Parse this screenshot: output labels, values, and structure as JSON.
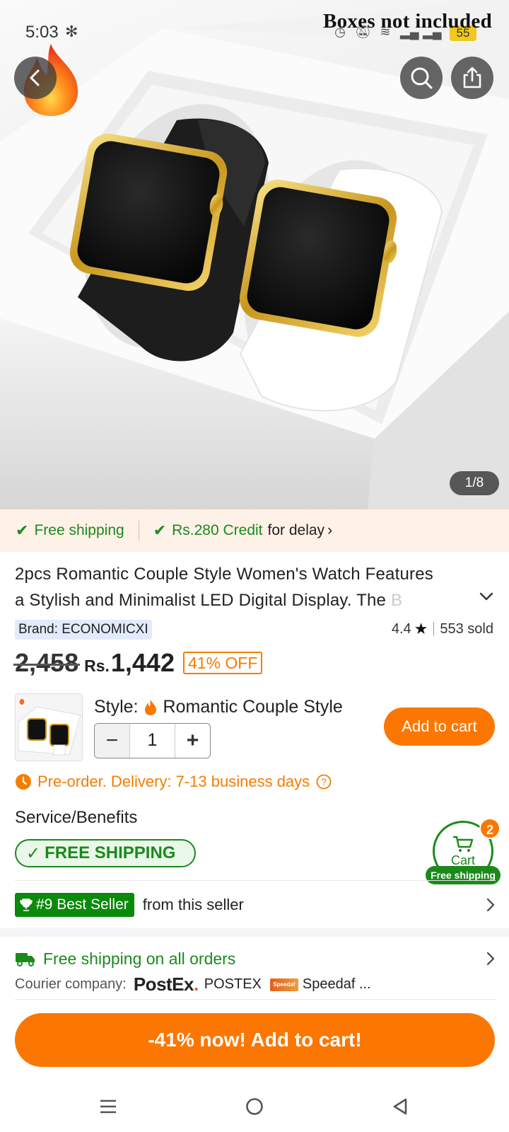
{
  "status_bar": {
    "time": "5:03",
    "battery": "55"
  },
  "hero": {
    "overlay_text": "Boxes not included",
    "image_counter": "1/8",
    "icons": [
      "back-icon",
      "search-icon",
      "share-icon",
      "flame-icon"
    ]
  },
  "promo": {
    "free_shipping": "Free shipping",
    "credit_amount": "Rs.280 Credit",
    "credit_suffix": "for delay"
  },
  "product": {
    "title_line1": "2pcs Romantic Couple Style Women's Watch Features",
    "title_line2": "a Stylish and Minimalist LED Digital Display. The",
    "title_fade": "B",
    "brand": "Brand: ECONOMICXI",
    "rating": "4.4",
    "sold": "553 sold",
    "old_price": "2,458",
    "currency": "Rs.",
    "price": "1,442",
    "discount": "41% OFF",
    "style_label": "Style:",
    "style_value": "Romantic Couple Style",
    "quantity": "1",
    "add_to_cart": "Add to cart",
    "preorder": "Pre-order. Delivery: 7-13 business days"
  },
  "service": {
    "title": "Service/Benefits",
    "free_shipping_pill": "FREE SHIPPING"
  },
  "cart": {
    "label": "Cart",
    "count": "2",
    "free_shipping": "Free shipping"
  },
  "seller": {
    "badge": "#9 Best Seller",
    "suffix": "from this seller"
  },
  "shipping": {
    "title": "Free shipping on all orders",
    "courier_label": "Courier company:",
    "postex_logo": "PostEx",
    "postex_name": "POSTEX",
    "speedaf_logo": "Speedaf",
    "speedaf_name": "Speedaf ..."
  },
  "cta": {
    "label": "-41% now! Add to cart!"
  },
  "colors": {
    "accent_orange": "#fb7701",
    "green": "#1b8a1b",
    "promo_bg": "#fdf1e8"
  }
}
